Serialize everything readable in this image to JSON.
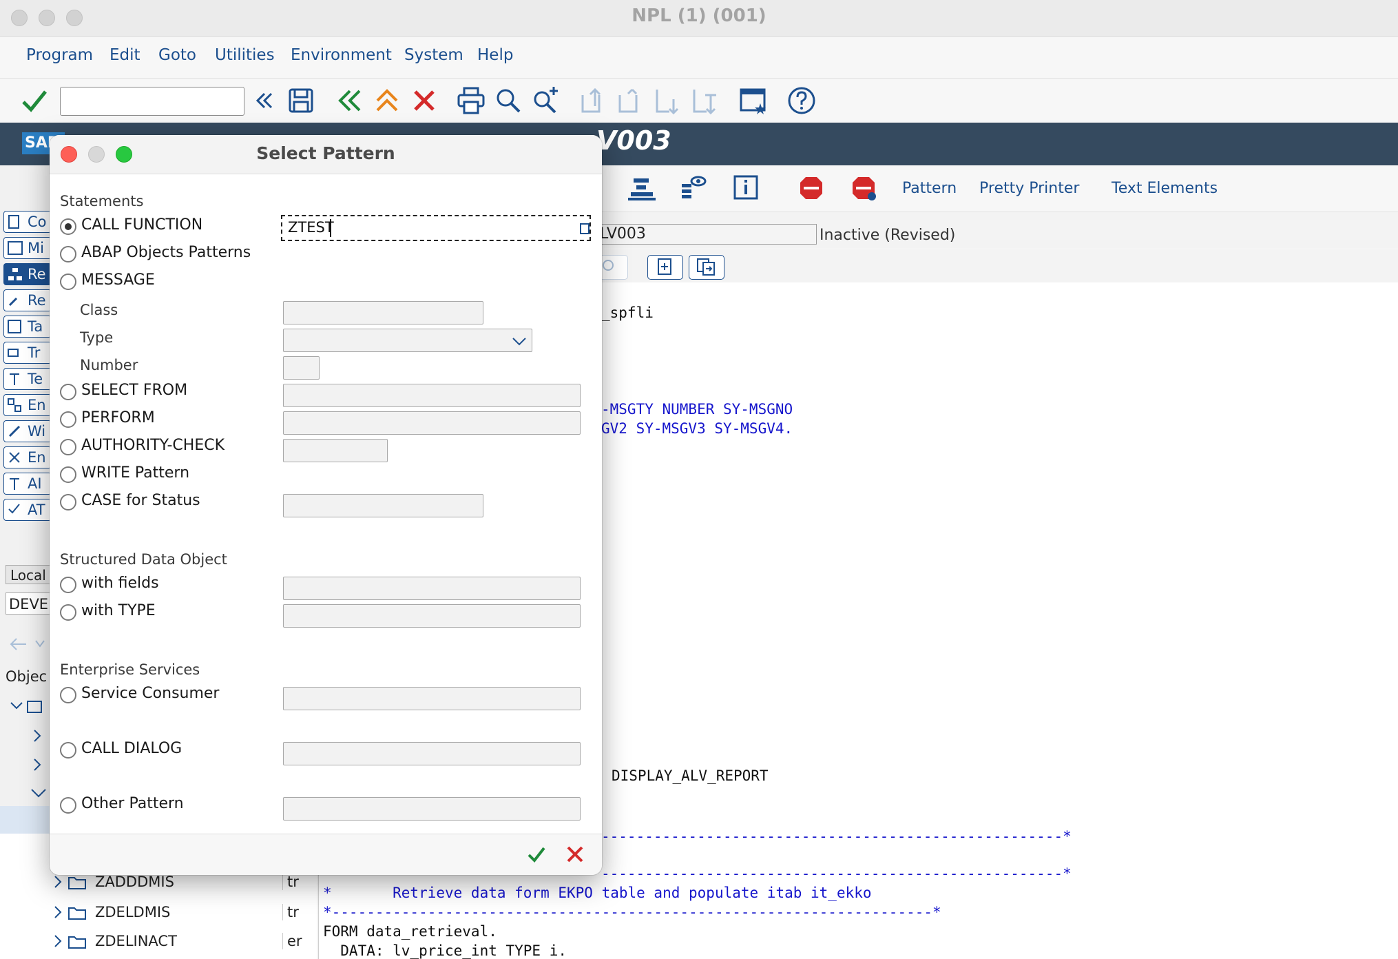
{
  "window": {
    "title": "NPL (1) (001)"
  },
  "menu": {
    "items": [
      "Program",
      "Edit",
      "Goto",
      "Utilities",
      "Environment",
      "System",
      "Help"
    ]
  },
  "header": {
    "logo": "SAP",
    "program_title": "V003"
  },
  "app_toolbar": {
    "pattern": "Pattern",
    "pretty_printer": "Pretty Printer",
    "text_elements": "Text Elements"
  },
  "program_row": {
    "name": "LV003",
    "status": "Inactive (Revised)"
  },
  "left_nav": {
    "buttons": [
      "Co",
      "Mi",
      "Re",
      "Re",
      "Ta",
      "Tr",
      "Te",
      "En",
      "Wi",
      "En",
      "AI",
      "AT"
    ],
    "local": "Local",
    "deve": "DEVE",
    "objects": "Objec"
  },
  "tree": {
    "rows": [
      {
        "name": "ZADDDMIS",
        "col": "tr"
      },
      {
        "name": "ZDELDMIS",
        "col": "tr"
      },
      {
        "name": "ZDELINACT",
        "col": "er"
      }
    ]
  },
  "code": {
    "lines": [
      "_spfli",
      "-MSGTY NUMBER SY-MSGNO",
      "GV2 SY-MSGV3 SY-MSGV4.",
      "DISPLAY_ALV_REPORT",
      "-----------------------------------------------------*",
      "-----------------------------------------------------*",
      "*       Retrieve data form EKPO table and populate itab it_ekko",
      "*---------------------------------------------------------------------*",
      "FORM data_retrieval.",
      "  DATA: lv_price_int TYPE i."
    ]
  },
  "dialog": {
    "title": "Select Pattern",
    "sections": {
      "statements": "Statements",
      "structured": "Structured Data Object",
      "enterprise": "Enterprise Services"
    },
    "options": {
      "call_function": "CALL FUNCTION",
      "abap_objects": "ABAP Objects Patterns",
      "message": "MESSAGE",
      "select_from": "SELECT FROM",
      "perform": "PERFORM",
      "authority_check": "AUTHORITY-CHECK",
      "write_pattern": "WRITE Pattern",
      "case_status": "CASE for Status",
      "with_fields": "with fields",
      "with_type": "with TYPE",
      "service_consumer": "Service Consumer",
      "call_dialog": "CALL DIALOG",
      "other_pattern": "Other Pattern"
    },
    "sub_labels": {
      "class": "Class",
      "type": "Type",
      "number": "Number"
    },
    "call_function_value": "ZTEST",
    "selected": "call_function"
  },
  "colors": {
    "accent": "#1c4f8e",
    "header_bg": "#354a5f",
    "ok_green": "#1f8a3a",
    "cancel_red": "#d42a2a"
  }
}
